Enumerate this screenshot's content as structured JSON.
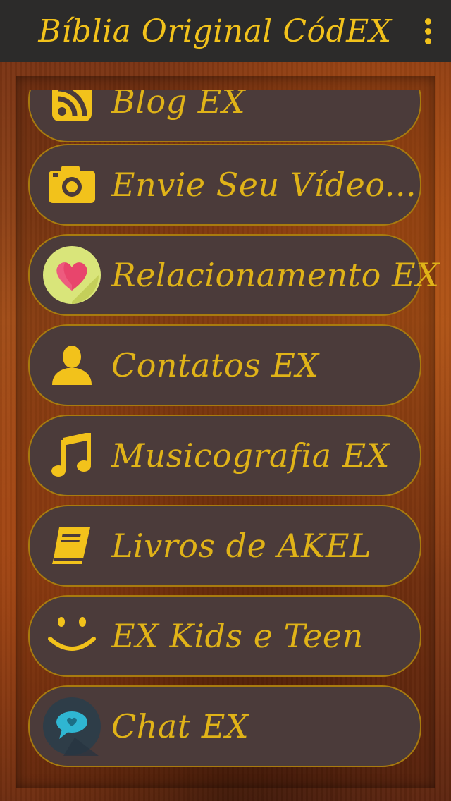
{
  "app_bar": {
    "title": "Bíblia Original CódEX",
    "menu_icon": "overflow-menu-icon"
  },
  "colors": {
    "accent": "#f2c21b",
    "label": "#e0b318",
    "item_bg": "#4b3b3a",
    "item_border": "#a87b0e",
    "app_bar_bg": "#2c2b2a"
  },
  "menu": {
    "items": [
      {
        "label": "Blog EX",
        "icon": "rss-icon"
      },
      {
        "label": "Envie Seu Vídeo...",
        "icon": "camera-icon"
      },
      {
        "label": "Relacionamento EX",
        "icon": "heart-icon"
      },
      {
        "label": "Contatos EX",
        "icon": "person-icon"
      },
      {
        "label": "Musicografia EX",
        "icon": "music-note-icon"
      },
      {
        "label": "Livros de AKEL",
        "icon": "book-icon"
      },
      {
        "label": "EX Kids e Teen",
        "icon": "smiley-icon"
      },
      {
        "label": "Chat EX",
        "icon": "chat-bubble-icon"
      }
    ]
  }
}
